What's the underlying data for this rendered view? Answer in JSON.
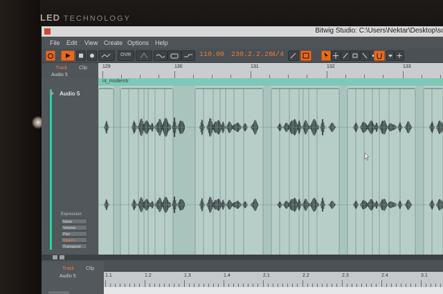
{
  "monitor": {
    "brand": "LED",
    "brand_suffix": "TECHNOLOGY"
  },
  "window": {
    "title": "Bitwig Studio: C:\\Users\\Nektar\\Desktop\\sor"
  },
  "menu": [
    "File",
    "Edit",
    "View",
    "Create",
    "Options",
    "Help"
  ],
  "transport": {
    "tempo": "110.00",
    "position": "230.2.2.26",
    "time_signature": "4/4",
    "ovr_label": "OVR"
  },
  "panel_tabs": {
    "track": "Track",
    "clip": "Clip"
  },
  "track": {
    "name": "Audio 5",
    "header_name": "Audio 5"
  },
  "clip": {
    "name": "nt_moderntr"
  },
  "ruler_bars": [
    "129",
    "130",
    "131",
    "132",
    "133"
  ],
  "expression": {
    "title": "Expression",
    "buttons": [
      "None",
      "Volume",
      "Pan",
      "Stretch",
      "Transpose"
    ],
    "active": "Stretch"
  },
  "lower": {
    "tabs": {
      "track": "Track",
      "clip": "Clip"
    },
    "track_name": "Audio 5",
    "ruler": [
      "1.1",
      "1.2",
      "1.3",
      "1.4",
      "2.1",
      "2.2",
      "2.3",
      "2.4",
      "3.1"
    ]
  },
  "colors": {
    "accent_orange": "#e86a1e",
    "track_accent": "#1fd6a6",
    "clip_header": "#7fc7b8",
    "waveform": "#2e3a3a"
  }
}
